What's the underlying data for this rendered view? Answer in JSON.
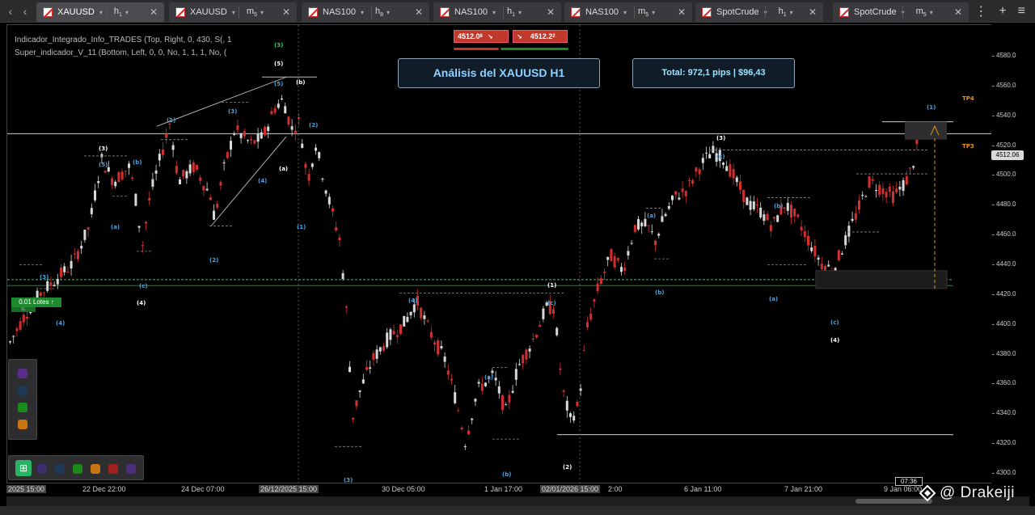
{
  "tabs": [
    {
      "symbol": "XAUUSD",
      "tf_main": "h",
      "tf_sub": "1",
      "active": true
    },
    {
      "symbol": "XAUUSD",
      "tf_main": "m",
      "tf_sub": "5",
      "active": false
    },
    {
      "symbol": "NAS100",
      "tf_main": "h",
      "tf_sub": "8",
      "active": false
    },
    {
      "symbol": "NAS100",
      "tf_main": "h",
      "tf_sub": "1",
      "active": false
    },
    {
      "symbol": "NAS100",
      "tf_main": "m",
      "tf_sub": "5",
      "active": false
    },
    {
      "symbol": "SpotCrude",
      "tf_main": "h",
      "tf_sub": "1",
      "active": false
    },
    {
      "symbol": "SpotCrude",
      "tf_main": "m",
      "tf_sub": "5",
      "active": false
    }
  ],
  "tab_tools": {
    "more": "⋮",
    "add": "+",
    "menu": "≡"
  },
  "indicators": [
    "Indicador_Integrado_Info_TRADES (Top, Right, 0, 430, S(, 1",
    "Super_indicador_V_11 (Bottom, Left, 0, 0, No, 1, 1, 1, No, ("
  ],
  "trade_buttons": {
    "sell": "4512.0",
    "sell_sup": "8",
    "buy": "4512.2",
    "buy_sup": "2"
  },
  "info_box": "Análisis del  XAUUSD  H1",
  "total_box": "Total: 972,1 pips | $96,43",
  "lotes": "0.01 Lotes ↑",
  "sl_label": "SL",
  "current_price": "4512.06",
  "time_bubble": "07:36",
  "watermark": "@ Drakeiji",
  "price_ticks": [
    "4580.0",
    "4560.0",
    "4540.0",
    "4520.0",
    "4500.0",
    "4480.0",
    "4460.0",
    "4440.0",
    "4420.0",
    "4400.0",
    "4380.0",
    "4360.0",
    "4340.0",
    "4320.0",
    "4300.0"
  ],
  "time_ticks": [
    {
      "label": "2025 15:00",
      "hl": true
    },
    {
      "label": "22 Dec 22:00",
      "hl": false
    },
    {
      "label": "24 Dec 07:00",
      "hl": false
    },
    {
      "label": "26/12/2025 15:00",
      "hl": true
    },
    {
      "label": "30 Dec 05:00",
      "hl": false
    },
    {
      "label": "1 Jan 17:00",
      "hl": false
    },
    {
      "label": "02/01/2026 15:00",
      "hl": true
    },
    {
      "label": "2:00",
      "hl": false
    },
    {
      "label": "6 Jan 11:00",
      "hl": false
    },
    {
      "label": "7 Jan 21:00",
      "hl": false
    },
    {
      "label": "9 Jan 06:00",
      "hl": false
    }
  ],
  "tp_labels": {
    "tp4": "TP4",
    "tp3": "TP3"
  },
  "wave_labels": {
    "w_3g": "(3)",
    "w_5w": "(5)",
    "w_5b": "(5)",
    "w_b1": "(b)",
    "w_3a": "(3)",
    "w_5c": "(5)",
    "w_bc": "(b)",
    "w_1a": "(1)",
    "w_3b": "(3)",
    "w_2a": "(2)",
    "w_a1": "(a)",
    "w_4a": "(4)",
    "w_2b": "(2)",
    "w_c1": "(c)",
    "w_4b": "(4)",
    "w_a2": "(a)",
    "w_1b": "(1)",
    "w_3c": "(3)",
    "w_4c": "(4)",
    "w_4d": "(4)",
    "w_3d": "(3)",
    "w_1c": "(1)",
    "w_c2": "(c)",
    "w_a3": "(a)",
    "w_b2": "(b)",
    "w_2c": "(2)",
    "w_3e": "(3)",
    "w_c3": "(c)",
    "w_a4": "(a)",
    "w_b3": "(b)",
    "w_b4": "(b)",
    "w_a5": "(a)",
    "w_c4": "(c)",
    "w_4e": "(4)",
    "w_1d": "(1)",
    "w_3f": "(3)"
  },
  "colors": {
    "bull": "#d9d9d9",
    "bear": "#d32f2f",
    "wave_blue": "#4aa3df",
    "wave_white": "#ffffff",
    "wave_green": "#2ecc71",
    "accent_green": "#1e8a2e",
    "tp_orange": "#e69419"
  },
  "palette_colors": [
    "#5b2d8a",
    "#1f3a56",
    "#1a8a1a",
    "#c77612"
  ],
  "palette2_colors": [
    "#3d2e6f",
    "#1f3a56",
    "#1a8a1a",
    "#c77612",
    "#a01f1f",
    "#4b2f7a"
  ]
}
